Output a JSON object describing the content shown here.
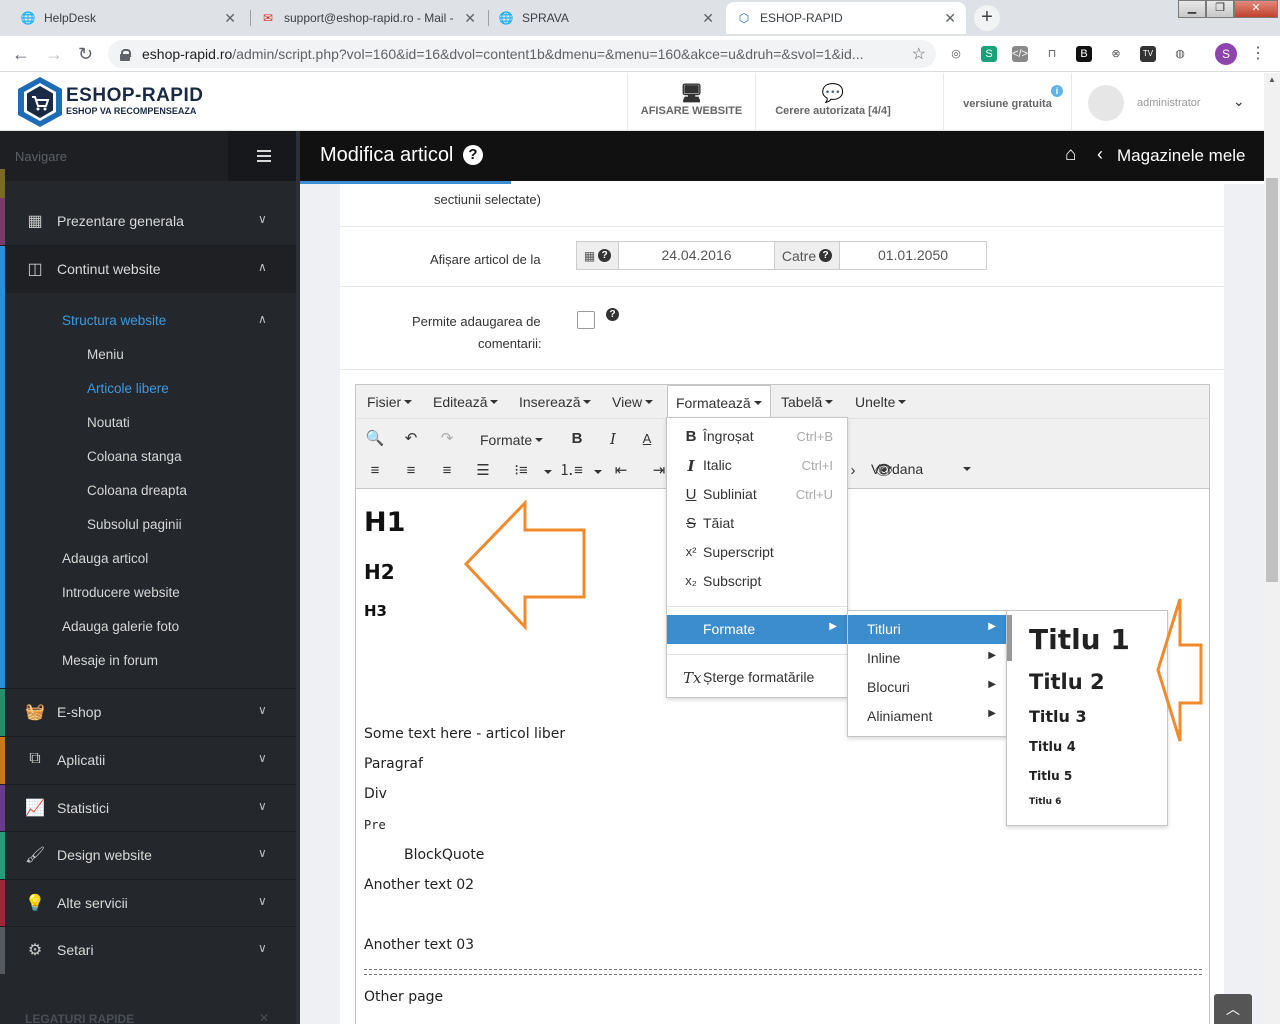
{
  "browser": {
    "tabs": [
      {
        "title": "HelpDesk"
      },
      {
        "title": "support@eshop-rapid.ro - Mail -"
      },
      {
        "title": "SPRAVA"
      },
      {
        "title": "ESHOP-RAPID"
      }
    ],
    "url_host": "eshop-rapid.ro",
    "url_path": "/admin/script.php?vol=160&id=16&dvol=content1b&dmenu=&menu=160&akce=u&druh=&svol=1&id...",
    "profile_initial": "S"
  },
  "header": {
    "logo_title": "ESHOP-RAPID",
    "logo_subtitle": "ESHOP VA RECOMPENSEAZA",
    "afisare_website": "AFISARE WEBSITE",
    "cerere": "Cerere autorizata [4/4]",
    "versiune": "versiune gratuita",
    "user": "administrator"
  },
  "sidebar": {
    "nav_label": "Navigare",
    "items": [
      {
        "label": "Prezentare generala",
        "color": "#7a3a6a"
      },
      {
        "label": "Continut website",
        "color": "#2a8fd6"
      },
      {
        "label": "E-shop",
        "color": "#2c8c6a"
      },
      {
        "label": "Aplicatii",
        "color": "#c47a1a"
      },
      {
        "label": "Statistici",
        "color": "#6a3a8a"
      },
      {
        "label": "Design website",
        "color": "#2a9a7a"
      },
      {
        "label": "Alte servicii",
        "color": "#9a2a3a"
      },
      {
        "label": "Setari",
        "color": "#555a60"
      }
    ],
    "sub": {
      "structura": "Structura website",
      "meniu": "Meniu",
      "articole": "Articole libere",
      "noutati": "Noutati",
      "col_stanga": "Coloana stanga",
      "col_dreapta": "Coloana dreapta",
      "subsol": "Subsolul paginii",
      "adauga_articol": "Adauga articol",
      "introducere": "Introducere website",
      "galerie": "Adauga galerie foto",
      "mesaje": "Mesaje in forum"
    },
    "legaturi": "LEGATURI RAPIDE"
  },
  "page": {
    "title": "Modifica articol",
    "magazine": "Magazinele mele",
    "sectiuni_text": "sectiunii selectate)",
    "afisare_label": "Afișare articol de la",
    "date_from": "24.04.2016",
    "catre": "Catre",
    "date_to": "01.01.2050",
    "permite_1": "Permite adaugarea de",
    "permite_2": "comentarii:"
  },
  "editor": {
    "menus": [
      "Fisier",
      "Editează",
      "Inserează",
      "View",
      "Formatează",
      "Tabelă",
      "Unelte"
    ],
    "formats_label": "Formate",
    "font": "Verdana",
    "content": {
      "h1": "H1",
      "h2": "H2",
      "h3": "H3",
      "p1": "Some text here - articol liber",
      "p2": "Paragraf",
      "p3": "Div",
      "p4": "Pre",
      "p5": "BlockQuote",
      "p6": "Another text 02",
      "p7": "Another text 03",
      "p8": "Other page"
    },
    "format_menu": {
      "bold": "Îngroșat",
      "bold_sc": "Ctrl+B",
      "italic": "Italic",
      "italic_sc": "Ctrl+I",
      "underline": "Subliniat",
      "underline_sc": "Ctrl+U",
      "strike": "Tăiat",
      "sup": "Superscript",
      "sub": "Subscript",
      "formats": "Formate",
      "clear": "Șterge formatările"
    },
    "formats_submenu": [
      "Titluri",
      "Inline",
      "Blocuri",
      "Aliniament"
    ],
    "titluri": [
      "Titlu 1",
      "Titlu 2",
      "Titlu 3",
      "Titlu 4",
      "Titlu 5",
      "Titlu 6"
    ]
  },
  "colors": {
    "accent_blue": "#3c8dce",
    "arrow_orange": "#f08a2c",
    "sidebar_bg": "#24272c"
  }
}
